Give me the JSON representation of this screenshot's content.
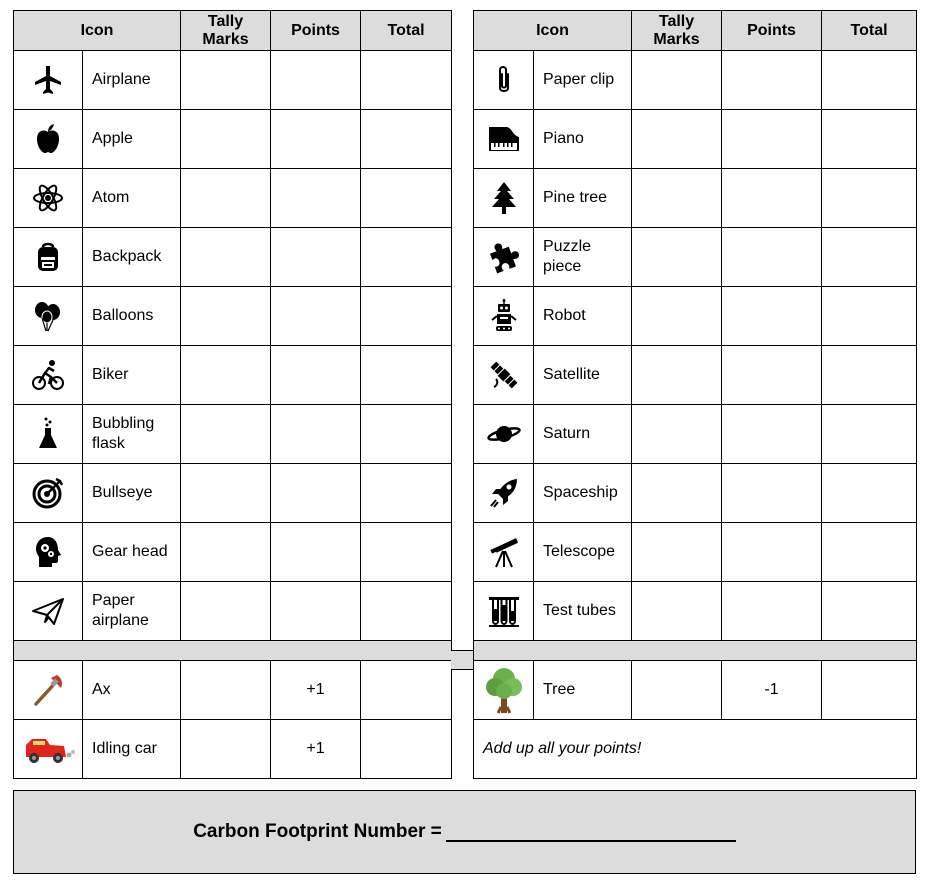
{
  "headers": {
    "icon": "Icon",
    "tally_line1": "Tally",
    "tally_line2": "Marks",
    "points": "Points",
    "total": "Total"
  },
  "left_items": [
    {
      "label": "Airplane",
      "icon": "airplane-icon"
    },
    {
      "label": "Apple",
      "icon": "apple-icon"
    },
    {
      "label": "Atom",
      "icon": "atom-icon"
    },
    {
      "label": "Backpack",
      "icon": "backpack-icon"
    },
    {
      "label": "Balloons",
      "icon": "balloons-icon"
    },
    {
      "label": "Biker",
      "icon": "biker-icon"
    },
    {
      "label": "Bubbling flask",
      "icon": "flask-icon"
    },
    {
      "label": "Bullseye",
      "icon": "bullseye-icon"
    },
    {
      "label": "Gear head",
      "icon": "gear-head-icon"
    },
    {
      "label": "Paper airplane",
      "icon": "paper-airplane-icon"
    }
  ],
  "right_items": [
    {
      "label": "Paper clip",
      "icon": "paper-clip-icon"
    },
    {
      "label": "Piano",
      "icon": "piano-icon"
    },
    {
      "label": "Pine tree",
      "icon": "pine-tree-icon"
    },
    {
      "label": "Puzzle piece",
      "icon": "puzzle-piece-icon"
    },
    {
      "label": "Robot",
      "icon": "robot-icon"
    },
    {
      "label": "Satellite",
      "icon": "satellite-icon"
    },
    {
      "label": "Saturn",
      "icon": "saturn-icon"
    },
    {
      "label": "Spaceship",
      "icon": "spaceship-icon"
    },
    {
      "label": "Telescope",
      "icon": "telescope-icon"
    },
    {
      "label": "Test tubes",
      "icon": "test-tubes-icon"
    }
  ],
  "left_scoring": [
    {
      "label": "Ax",
      "points": "+1",
      "icon": "ax-icon"
    },
    {
      "label": "Idling car",
      "points": "+1",
      "icon": "idling-car-icon"
    }
  ],
  "right_scoring": [
    {
      "label": "Tree",
      "points": "-1",
      "icon": "tree-icon"
    }
  ],
  "note": "Add up all your points!",
  "footer": {
    "label": "Carbon Footprint Number ="
  },
  "colors": {
    "header_bg": "#dcdcdc",
    "grid_line": "#000000",
    "ax_head": "#c0392b",
    "car_body": "#e0251b",
    "tree_green": "#6ab04c",
    "tree_trunk": "#7a4a1e"
  }
}
